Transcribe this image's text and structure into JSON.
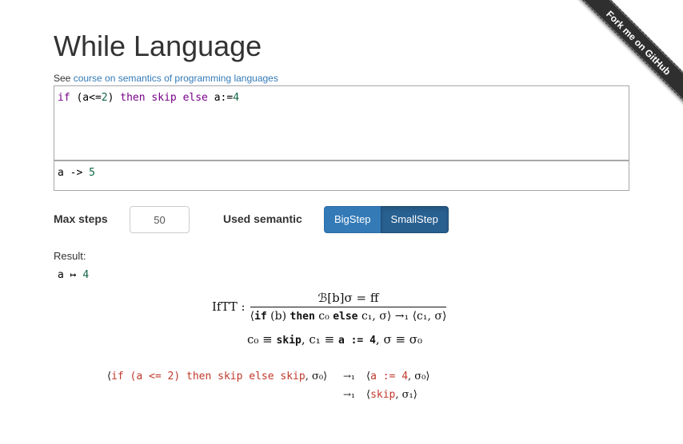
{
  "header": {
    "title": "While Language",
    "see_prefix": "See",
    "see_link": "course on semantics of programming languages"
  },
  "ribbon": {
    "label": "Fork me on GitHub"
  },
  "editor": {
    "tokens": [
      "if",
      " (a<=",
      "2",
      ") ",
      "then",
      " ",
      "skip",
      " ",
      "else",
      " a:=",
      "4"
    ]
  },
  "output": {
    "var": "a ->",
    "value": "5"
  },
  "controls": {
    "max_steps_label": "Max steps",
    "max_steps_value": "50",
    "semantic_label": "Used semantic",
    "bigstep_label": "BigStep",
    "smallstep_label": "SmallStep",
    "selected": "SmallStep"
  },
  "result": {
    "label": "Result:",
    "var": "a ↦",
    "value": "4"
  },
  "rule": {
    "name": "IfTT :",
    "premise": "ℬ[b]σ = ff",
    "conclusion_left": "⟨",
    "conclusion_if": "if",
    "conclusion_cond": "(b)",
    "conclusion_then": "then",
    "conclusion_c0": "c₀",
    "conclusion_else": "else",
    "conclusion_rest": "c₁, σ⟩ →₁ ⟨c₁, σ⟩",
    "side_c0": "c₀ ≡",
    "side_skip": "skip",
    "side_c1": ", c₁ ≡",
    "side_assign": "a := 4",
    "side_sigma": ", σ ≡ σ₀"
  },
  "derivation": {
    "step1_open": "⟨",
    "step1_code": "if (a <= 2) then skip else skip",
    "step1_close": ", σ₀⟩",
    "arrow": "→₁",
    "step2_open": "⟨",
    "step2_code": "a := 4",
    "step2_close": ", σ₀⟩",
    "step3_open": "⟨",
    "step3_code": "skip",
    "step3_close": ", σ₁⟩"
  }
}
